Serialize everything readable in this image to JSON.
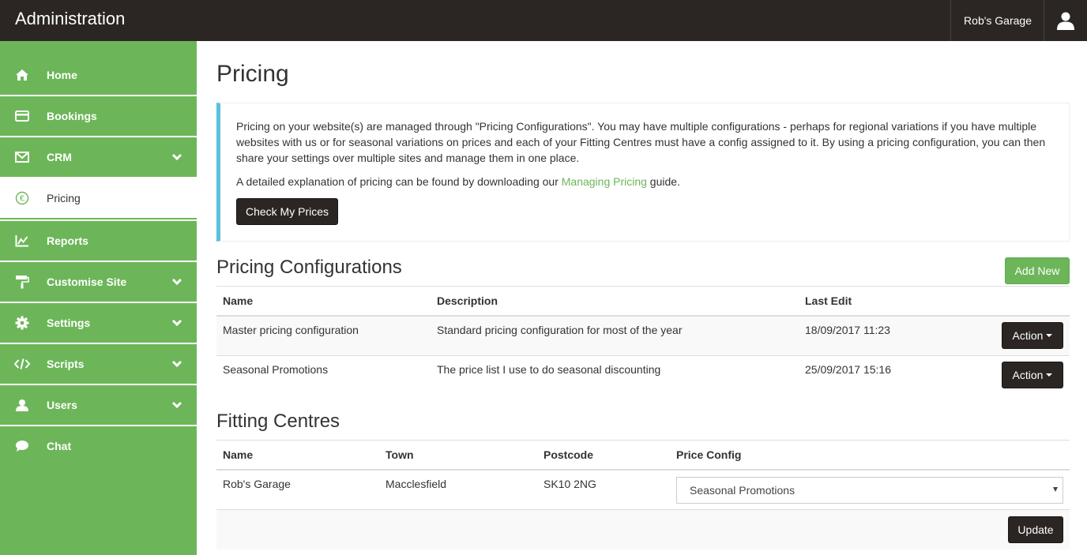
{
  "header": {
    "title": "Administration",
    "site_name": "Rob's Garage",
    "user_icon": "user-icon"
  },
  "sidebar": {
    "items": [
      {
        "label": "Home",
        "icon": "home-icon"
      },
      {
        "label": "Bookings",
        "icon": "credit-card-icon"
      },
      {
        "label": "CRM",
        "icon": "envelope-icon",
        "has_submenu": true
      },
      {
        "label": "Pricing",
        "icon": "euro-icon",
        "active": true
      },
      {
        "label": "Reports",
        "icon": "line-chart-icon"
      },
      {
        "label": "Customise Site",
        "icon": "paint-roller-icon",
        "has_submenu": true
      },
      {
        "label": "Settings",
        "icon": "gear-icon",
        "has_submenu": true
      },
      {
        "label": "Scripts",
        "icon": "code-icon",
        "has_submenu": true
      },
      {
        "label": "Users",
        "icon": "users-icon",
        "has_submenu": true
      },
      {
        "label": "Chat",
        "icon": "chat-icon"
      }
    ]
  },
  "main": {
    "title": "Pricing",
    "info": {
      "paragraph1": "Pricing on your website(s) are managed through \"Pricing Configurations\". You may have multiple configurations - perhaps for regional variations if you have multiple websites with us or for seasonal variations on prices and each of your Fitting Centres must have a config assigned to it. By using a pricing configuration, you can then share your settings over multiple sites and manage them in one place.",
      "paragraph2_before": "A detailed explanation of pricing can be found by downloading our ",
      "paragraph2_link": "Managing Pricing",
      "paragraph2_after": " guide.",
      "check_button": "Check My Prices"
    },
    "configurations": {
      "title": "Pricing Configurations",
      "add_button": "Add New",
      "columns": [
        "Name",
        "Description",
        "Last Edit"
      ],
      "rows": [
        {
          "name": "Master pricing configuration",
          "description": "Standard pricing configuration for most of the year",
          "last_edit": "18/09/2017 11:23",
          "action": "Action"
        },
        {
          "name": "Seasonal Promotions",
          "description": "The price list I use to do seasonal discounting",
          "last_edit": "25/09/2017 15:16",
          "action": "Action"
        }
      ]
    },
    "fitting_centres": {
      "title": "Fitting Centres",
      "columns": [
        "Name",
        "Town",
        "Postcode",
        "Price Config"
      ],
      "rows": [
        {
          "name": "Rob's Garage",
          "town": "Macclesfield",
          "postcode": "SK10 2NG",
          "price_config": "Seasonal Promotions"
        }
      ],
      "update_button": "Update"
    }
  },
  "colors": {
    "brand_green": "#6cb659",
    "topbar_dark": "#2b2623",
    "callout_accent": "#5bc0de"
  }
}
